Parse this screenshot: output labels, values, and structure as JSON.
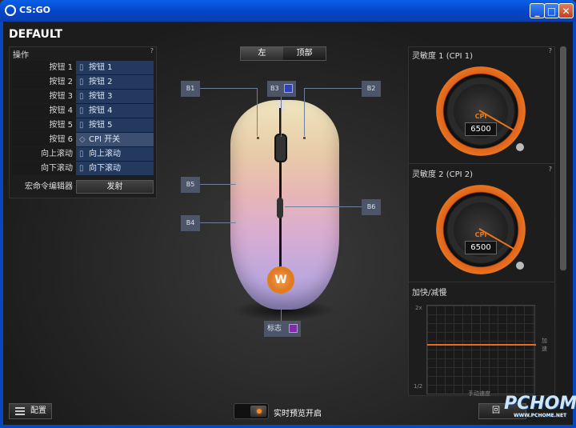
{
  "window": {
    "title": "CS:GO",
    "minimize": "_",
    "maximize": "□",
    "close": "✕"
  },
  "profile": {
    "name": "DEFAULT"
  },
  "actions": {
    "header": "操作",
    "help": "?",
    "rows": [
      {
        "label": "按钮 1",
        "value": "按钮 1",
        "prefix": "▯"
      },
      {
        "label": "按钮 2",
        "value": "按钮 2",
        "prefix": "▯"
      },
      {
        "label": "按钮 3",
        "value": "按钮 3",
        "prefix": "▯"
      },
      {
        "label": "按钮 4",
        "value": "按钮 4",
        "prefix": "▯"
      },
      {
        "label": "按钮 5",
        "value": "按钮 5",
        "prefix": "▯"
      },
      {
        "label": "按钮 6",
        "value": "CPI 开关",
        "prefix": "◇"
      },
      {
        "label": "向上滚动",
        "value": "向上滚动",
        "prefix": "▯"
      },
      {
        "label": "向下滚动",
        "value": "向下滚动",
        "prefix": "▯"
      }
    ],
    "macro_label": "宏命令编辑器",
    "macro_button": "发射"
  },
  "side_toggle": {
    "left": "左",
    "top": "顶部"
  },
  "mouse_labels": {
    "b1": "B1",
    "b2": "B2",
    "b3": "B3",
    "b4": "B4",
    "b5": "B5",
    "b6": "B6",
    "logo": "标志"
  },
  "sensitivity": [
    {
      "title": "灵敏度 1 (CPI 1)",
      "cpi_label": "CPI",
      "value": "6500",
      "help": "?"
    },
    {
      "title": "灵敏度 2 (CPI 2)",
      "cpi_label": "CPI",
      "value": "6500",
      "help": "?"
    }
  ],
  "acceleration": {
    "title": "加快/减慢",
    "y_top": "2x",
    "y_bottom": "1/2",
    "x_label": "手动速度",
    "side_label": "加速"
  },
  "footer": {
    "config_button": "配置",
    "live_preview": "实时预览开启",
    "back_button": "回"
  },
  "watermark": {
    "brand": "PCHOME",
    "url": "WWW.PCHOME.NET"
  },
  "colors": {
    "accent": "#e8741f",
    "button_blue": "#23395e",
    "logo_swatch": "#7f2ea8"
  }
}
